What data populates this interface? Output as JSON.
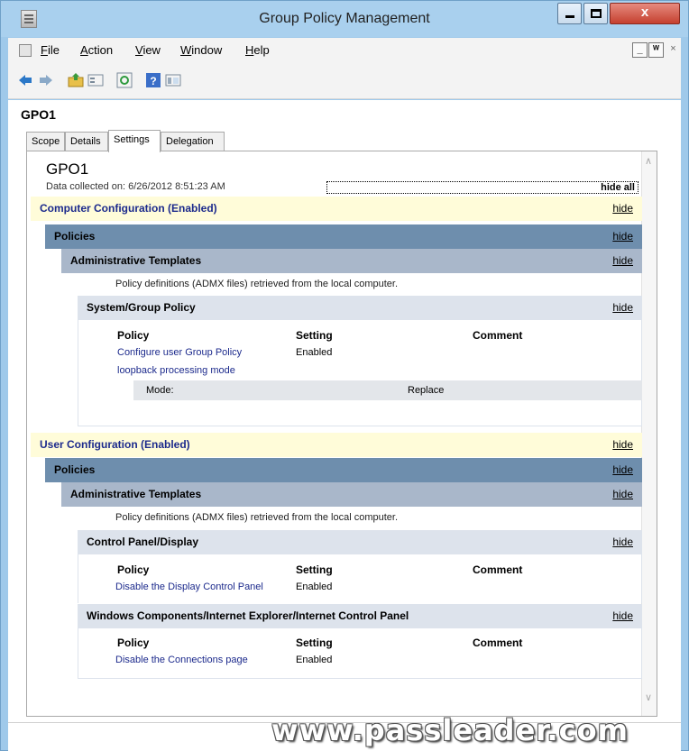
{
  "window": {
    "title": "Group Policy Management"
  },
  "window_controls": {
    "close_glyph": "x"
  },
  "menu": {
    "items": [
      "File",
      "Action",
      "View",
      "Window",
      "Help"
    ]
  },
  "mdi_controls": {
    "minimize": "_",
    "restore": "ᵂ",
    "close": "×"
  },
  "toolbar": {
    "icons": [
      "back-arrow-icon",
      "forward-arrow-icon",
      "folder-up-icon",
      "properties-icon",
      "refresh-icon",
      "help-icon",
      "view-pane-icon"
    ]
  },
  "pane": {
    "title": "GPO1",
    "tabs": [
      "Scope",
      "Details",
      "Settings",
      "Delegation"
    ],
    "active_tab": "Settings"
  },
  "report": {
    "gpo_name": "GPO1",
    "data_collected": "Data collected on: 6/26/2012 8:51:23 AM",
    "hide_all": "hide all",
    "hide": "hide",
    "computer": {
      "header": "Computer Configuration (Enabled)",
      "policies": "Policies",
      "admin_templates": "Administrative Templates",
      "admx_note": "Policy definitions (ADMX files) retrieved from the local computer.",
      "section": "System/Group Policy",
      "columns": [
        "Policy",
        "Setting",
        "Comment"
      ],
      "policy_line1": "Configure user Group Policy",
      "policy_line2": "loopback processing mode",
      "setting": "Enabled",
      "mode_label": "Mode:",
      "mode_value": "Replace"
    },
    "user": {
      "header": "User Configuration (Enabled)",
      "policies": "Policies",
      "admin_templates": "Administrative Templates",
      "admx_note": "Policy definitions (ADMX files) retrieved from the local computer.",
      "sections": [
        {
          "name": "Control Panel/Display",
          "policy": "Disable the Display Control Panel",
          "setting": "Enabled"
        },
        {
          "name": "Windows Components/Internet Explorer/Internet Control Panel",
          "policy": "Disable the Connections page",
          "setting": "Enabled"
        }
      ],
      "columns": [
        "Policy",
        "Setting",
        "Comment"
      ]
    }
  },
  "watermark": "www.passleader.com",
  "colors": {
    "title_bar": "#a9d0ee",
    "close_button": "#c5402f",
    "config_header": "#fffcd9",
    "policies_bar": "#6e8ead",
    "link": "#1c2a8c"
  }
}
